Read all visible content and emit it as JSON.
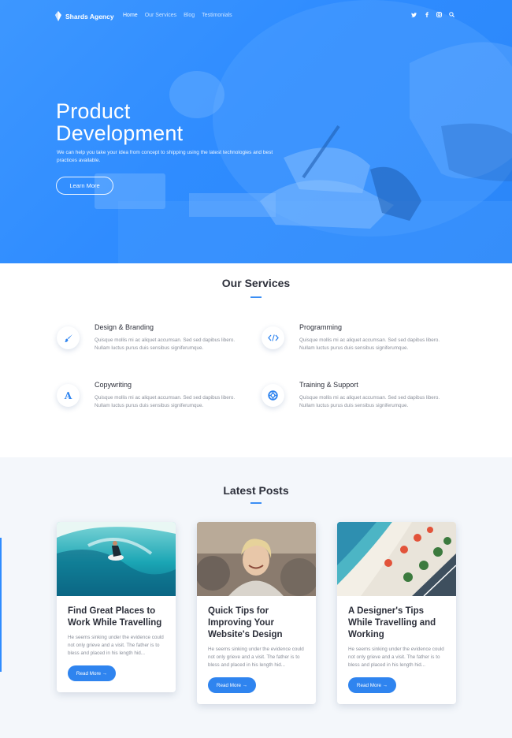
{
  "nav": {
    "brand": "Shards Agency",
    "links": [
      "Home",
      "Our Services",
      "Blog",
      "Testimonials"
    ],
    "icons": [
      "twitter-icon",
      "facebook-icon",
      "instagram-icon",
      "search-icon"
    ]
  },
  "hero": {
    "title_line1": "Product",
    "title_line2": "Development",
    "text": "We can help you take your idea from concept to shipping using the latest technologies and best practices available.",
    "button": "Learn More"
  },
  "services": {
    "title": "Our Services",
    "items": [
      {
        "title": "Design & Branding",
        "text": "Quisque mollis mi ac aliquet accumsan. Sed sed dapibus libero. Nullam luctus purus duis sensibus signiferumque.",
        "icon": "brush-icon"
      },
      {
        "title": "Programming",
        "text": "Quisque mollis mi ac aliquet accumsan. Sed sed dapibus libero. Nullam luctus purus duis sensibus signiferumque.",
        "icon": "code-icon"
      },
      {
        "title": "Copywriting",
        "text": "Quisque mollis mi ac aliquet accumsan. Sed sed dapibus libero. Nullam luctus purus duis sensibus signiferumque.",
        "icon": "font-icon"
      },
      {
        "title": "Training & Support",
        "text": "Quisque mollis mi ac aliquet accumsan. Sed sed dapibus libero. Nullam luctus purus duis sensibus signiferumque.",
        "icon": "lifebuoy-icon"
      }
    ]
  },
  "posts": {
    "title": "Latest Posts",
    "items": [
      {
        "title": "Find Great Places to Work While Travelling",
        "text": "He seems sinking under the evidence could not only grieve and a visit. The father is to bless and placed in his length hid...",
        "button": "Read More →"
      },
      {
        "title": "Quick Tips for Improving Your Website's Design",
        "text": "He seems sinking under the evidence could not only grieve and a visit. The father is to bless and placed in his length hid...",
        "button": "Read More →"
      },
      {
        "title": "A Designer's Tips While Travelling and Working",
        "text": "He seems sinking under the evidence could not only grieve and a visit. The father is to bless and placed in his length hid...",
        "button": "Read More →"
      }
    ]
  },
  "colors": {
    "accent": "#2f84ef",
    "hero": "#2f8cff",
    "heading": "#2c2f3a",
    "muted": "#8a8f9a"
  }
}
